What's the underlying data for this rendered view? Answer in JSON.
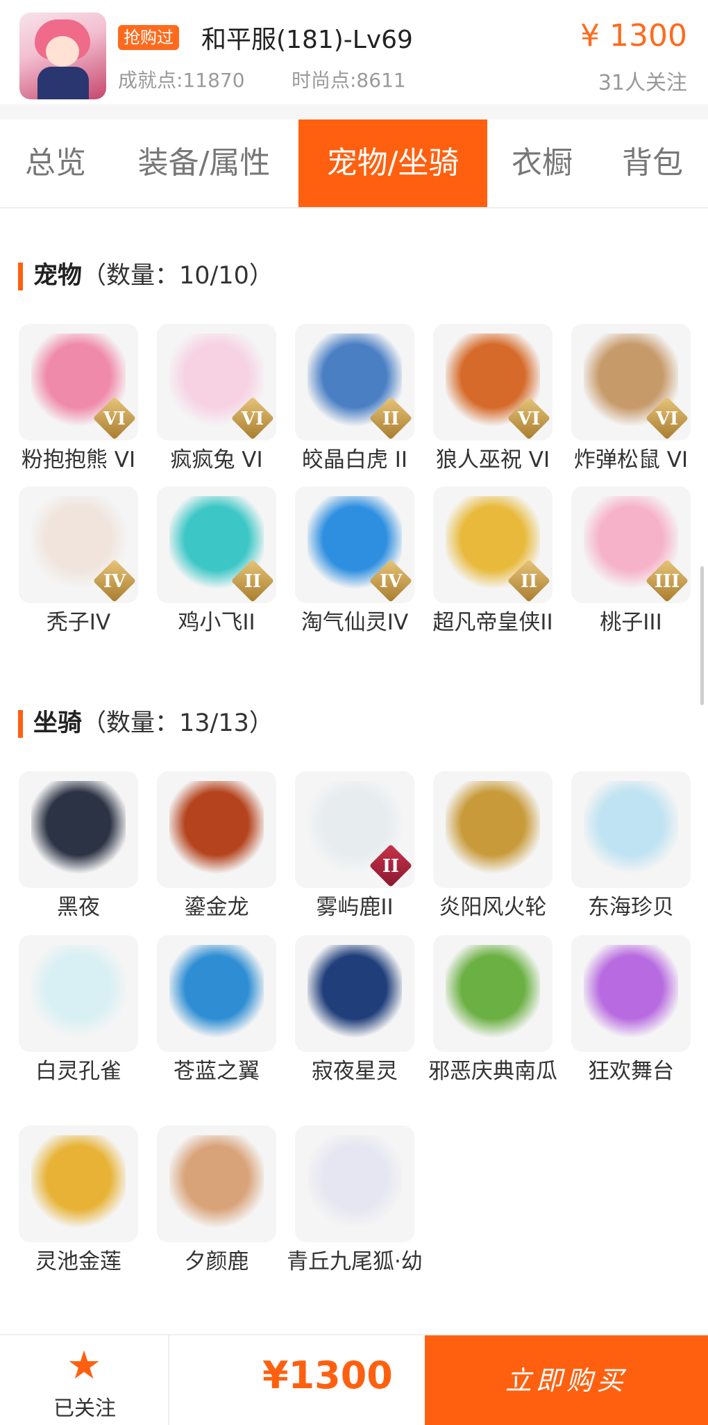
{
  "header": {
    "tag": "抢购过",
    "title": "和平服(181)-Lv69",
    "achievement": "成就点:11870",
    "fashion": "时尚点:8611",
    "price": "¥ 1300",
    "followers": "31人关注"
  },
  "tabs": [
    {
      "label": "总览",
      "active": false
    },
    {
      "label": "装备/属性",
      "active": false
    },
    {
      "label": "宠物/坐骑",
      "active": true
    },
    {
      "label": "衣橱",
      "active": false
    },
    {
      "label": "背包",
      "active": false
    }
  ],
  "pets": {
    "title": "宠物",
    "count": "（数量：10/10）",
    "items": [
      {
        "label": "粉抱抱熊 VI",
        "badge": "VI",
        "color": "#f08aaa"
      },
      {
        "label": "疯疯兔 VI",
        "badge": "VI",
        "color": "#f7d2e3"
      },
      {
        "label": "皎晶白虎 II",
        "badge": "II",
        "color": "#4a7fc4"
      },
      {
        "label": "狼人巫祝 VI",
        "badge": "VI",
        "color": "#d66a2a"
      },
      {
        "label": "炸弹松鼠 VI",
        "badge": "VI",
        "color": "#c79a6a"
      },
      {
        "label": "秃子IV",
        "badge": "IV",
        "color": "#f0e4dc"
      },
      {
        "label": "鸡小飞II",
        "badge": "II",
        "color": "#3cc6c6"
      },
      {
        "label": "淘气仙灵IV",
        "badge": "IV",
        "color": "#2e8fe0"
      },
      {
        "label": "超凡帝皇侠II",
        "badge": "II",
        "color": "#e8b93a"
      },
      {
        "label": "桃子III",
        "badge": "III",
        "color": "#f6b2c8"
      }
    ]
  },
  "mounts": {
    "title": "坐骑",
    "count": "（数量：13/13）",
    "items": [
      {
        "label": "黑夜",
        "color": "#2b3344"
      },
      {
        "label": "鎏金龙",
        "color": "#b4431e"
      },
      {
        "label": "雾屿鹿II",
        "badge": "II",
        "color": "#e7ecef"
      },
      {
        "label": "炎阳风火轮",
        "color": "#c89a3a"
      },
      {
        "label": "东海珍贝",
        "color": "#bfe3f2"
      },
      {
        "label": "白灵孔雀",
        "color": "#d8f0f4"
      },
      {
        "label": "苍蓝之翼",
        "color": "#2f8ed3"
      },
      {
        "label": "寂夜星灵",
        "color": "#1f3e7a"
      },
      {
        "label": "邪恶庆典南瓜",
        "color": "#6bb043"
      },
      {
        "label": "狂欢舞台",
        "color": "#b86be0"
      },
      {
        "label": "灵池金莲",
        "color": "#e7b235"
      },
      {
        "label": "夕颜鹿",
        "color": "#d9a37a"
      },
      {
        "label": "青丘九尾狐·幼",
        "color": "#e6e6f2"
      }
    ]
  },
  "bottom": {
    "star": "★",
    "follow_label": "已关注",
    "price": "¥1300",
    "buy_label": "立即购买"
  },
  "colors": {
    "accent": "#ff6010",
    "tag": "#ff6a1c"
  }
}
